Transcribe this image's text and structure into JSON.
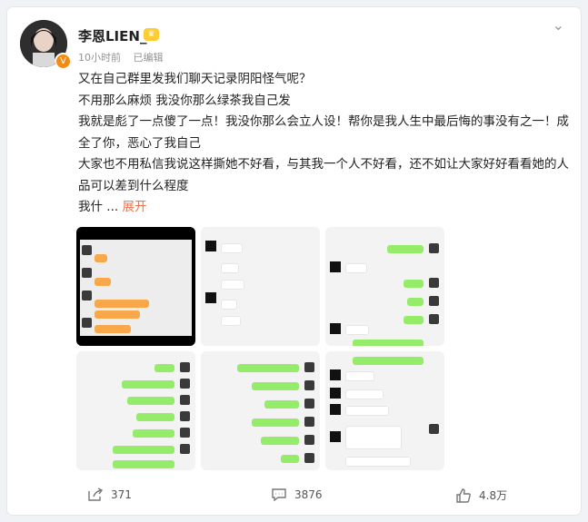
{
  "post": {
    "username": "李恩LIEN_",
    "time": "10小时前",
    "edited": "已编辑",
    "paragraphs": [
      "又在自己群里发我们聊天记录阴阳怪气呢？",
      "不用那么麻烦 我没你那么绿茶我自己发",
      "我就是彪了一点傻了一点！我没你那么会立人设！帮你是我人生中最后悔的事没有之一！成全了你，恶心了我自己",
      "大家也不用私信我说这样撕她不好看，与其我一个人不好看，还不如让大家好好看看她的人品可以差到什么程度"
    ],
    "truncated": "我什",
    "ellipsis": "...",
    "expand": "展开"
  },
  "actions": {
    "share_count": "371",
    "comment_count": "3876",
    "like_count": "4.8万"
  },
  "icons": [
    "more-chevron-icon",
    "verified-badge-icon",
    "vip-crown-icon",
    "share-icon",
    "comment-icon",
    "like-icon"
  ]
}
